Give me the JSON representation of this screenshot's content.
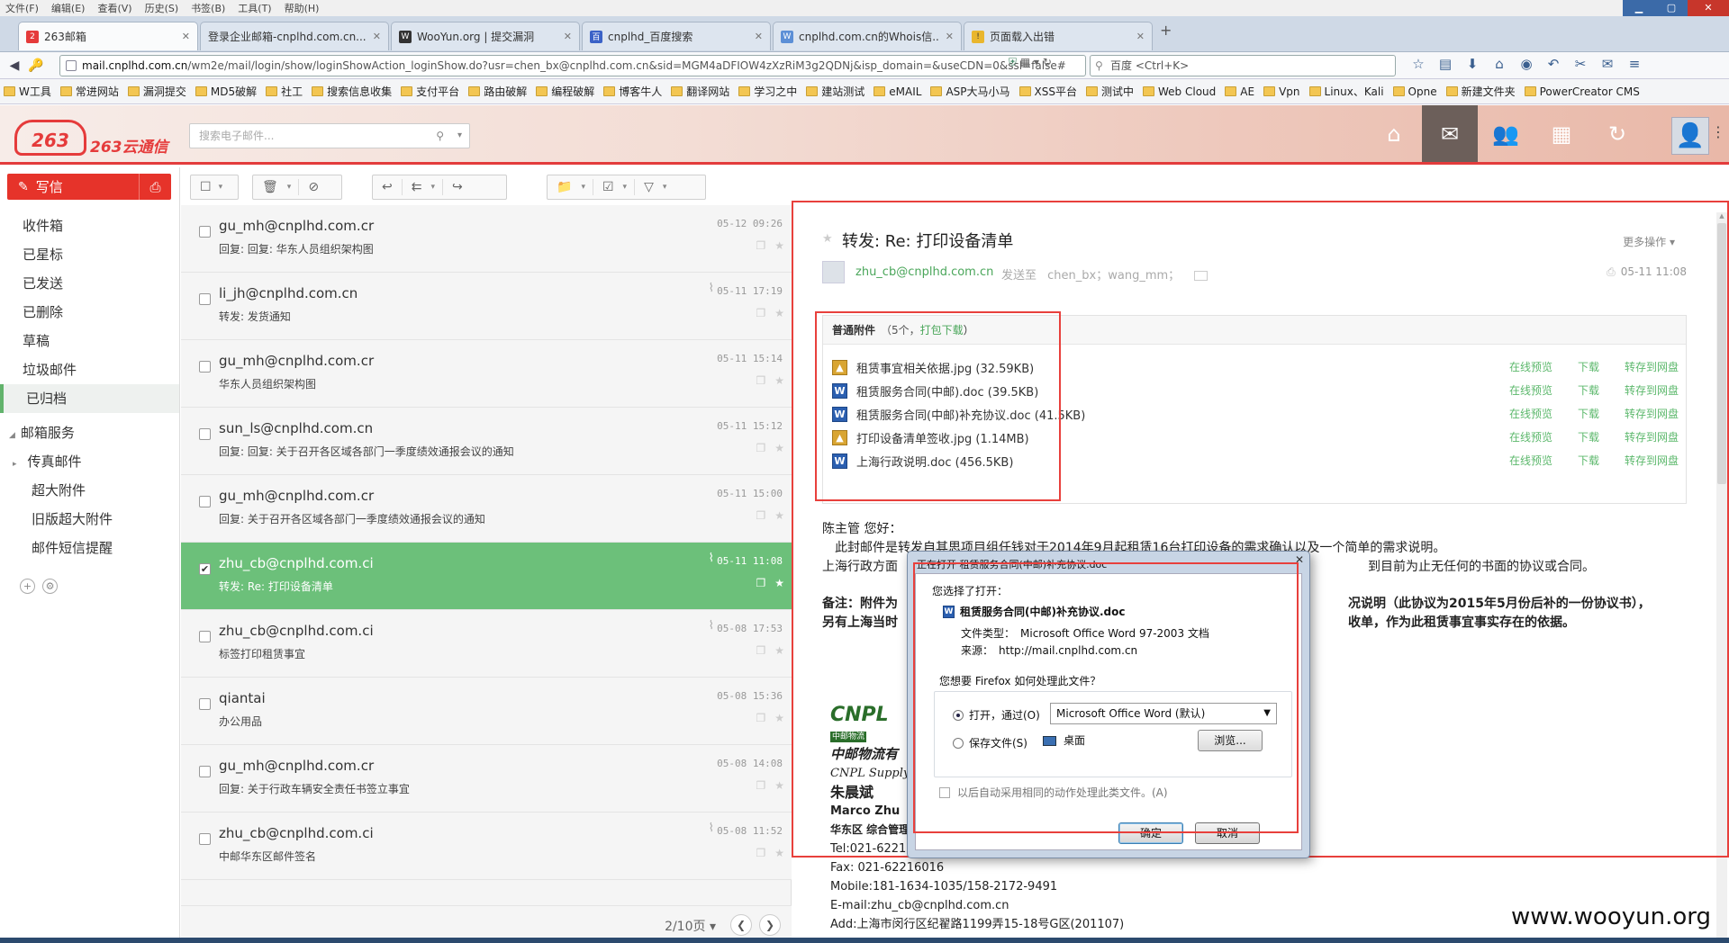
{
  "browser": {
    "menu": [
      "文件(F)",
      "编辑(E)",
      "查看(V)",
      "历史(S)",
      "书签(B)",
      "工具(T)",
      "帮助(H)"
    ],
    "tabs": [
      {
        "label": "263邮箱",
        "active": true
      },
      {
        "label": "登录企业邮箱-cnplhd.com.cn...",
        "active": false
      },
      {
        "label": "WooYun.org | 提交漏洞",
        "active": false
      },
      {
        "label": "cnplhd_百度搜索",
        "active": false
      },
      {
        "label": "cnplhd.com.cn的Whois信...",
        "active": false
      },
      {
        "label": "页面载入出错",
        "active": false
      }
    ],
    "url_host": "mail.cnplhd.com.cn",
    "url_path": "/wm2e/mail/login/show/loginShowAction_loginShow.do?usr=chen_bx@cnplhd.com.cn&sid=MGM4aDFIOW4zXzRiM3g2QDNj&isp_domain=&useCDN=0&ssl=false#",
    "search_placeholder": "百度 <Ctrl+K>",
    "bookmarks": [
      "W工具",
      "常进网站",
      "漏洞提交",
      "MD5破解",
      "社工",
      "搜索信息收集",
      "支付平台",
      "路由破解",
      "编程破解",
      "博客牛人",
      "翻译网站",
      "学习之中",
      "建站测试",
      "eMAIL",
      "ASP大马小马",
      "XSS平台",
      "测试中",
      "Web Cloud",
      "AE",
      "Vpn",
      "Linux、Kali",
      "Opne",
      "新建文件夹",
      "PowerCreator CMS"
    ]
  },
  "header": {
    "logo_text": "263云通信",
    "logo_mark": "263",
    "search_placeholder": "搜索电子邮件..."
  },
  "sidebar": {
    "compose_label": "写信",
    "items": [
      {
        "label": "收件箱"
      },
      {
        "label": "已星标"
      },
      {
        "label": "已发送"
      },
      {
        "label": "已删除"
      },
      {
        "label": "草稿"
      },
      {
        "label": "垃圾邮件"
      },
      {
        "label": "已归档",
        "selected": true
      }
    ],
    "service_head": "邮箱服务",
    "service_items": [
      {
        "label": "传真邮件"
      },
      {
        "label": "超大附件"
      },
      {
        "label": "旧版超大附件"
      },
      {
        "label": "邮件短信提醒"
      }
    ]
  },
  "mails": [
    {
      "from": "gu_mh@cnplhd.com.cr",
      "subject": "回复: 回复: 华东人员组织架构图",
      "date": "05-12 09:26",
      "attach": false,
      "selected": false
    },
    {
      "from": "li_jh@cnplhd.com.cn",
      "subject": "转发: 发货通知",
      "date": "05-11 17:19",
      "attach": true,
      "selected": false
    },
    {
      "from": "gu_mh@cnplhd.com.cr",
      "subject": "华东人员组织架构图",
      "date": "05-11 15:14",
      "attach": false,
      "selected": false
    },
    {
      "from": "sun_ls@cnplhd.com.cn",
      "subject": "回复: 回复: 关于召开各区域各部门一季度绩效通报会议的通知",
      "date": "05-11 15:12",
      "attach": false,
      "selected": false
    },
    {
      "from": "gu_mh@cnplhd.com.cr",
      "subject": "回复: 关于召开各区域各部门一季度绩效通报会议的通知",
      "date": "05-11 15:00",
      "attach": false,
      "selected": false
    },
    {
      "from": "zhu_cb@cnplhd.com.ci",
      "subject": "转发: Re: 打印设备清单",
      "date": "05-11 11:08",
      "attach": true,
      "selected": true
    },
    {
      "from": "zhu_cb@cnplhd.com.ci",
      "subject": "标签打印租赁事宜",
      "date": "05-08 17:53",
      "attach": true,
      "selected": false
    },
    {
      "from": "qiantai",
      "subject": "办公用品",
      "date": "05-08 15:36",
      "attach": false,
      "selected": false
    },
    {
      "from": "gu_mh@cnplhd.com.cr",
      "subject": "回复: 关于行政车辆安全责任书签立事宜",
      "date": "05-08 14:08",
      "attach": false,
      "selected": false
    },
    {
      "from": "zhu_cb@cnplhd.com.ci",
      "subject": "中邮华东区邮件签名",
      "date": "05-08 11:52",
      "attach": true,
      "selected": false
    }
  ],
  "pager": {
    "label": "2/10页"
  },
  "message": {
    "subject": "转发: Re: 打印设备清单",
    "more_label": "更多操作",
    "sender": "zhu_cb@cnplhd.com.cn",
    "to_label": "发送至",
    "recipients": "chen_bx；wang_mm；",
    "date": "05-11 11:08",
    "attach_title": "普通附件",
    "attach_count": "（5个，",
    "attach_pack": "打包下载",
    "attach_close": "）",
    "actions": [
      "在线预览",
      "下载",
      "转存到网盘"
    ],
    "attachments": [
      {
        "name": "租赁事宜相关依据.jpg (32.59KB)",
        "type": "img"
      },
      {
        "name": "租赁服务合同(中邮).doc (39.5KB)",
        "type": "doc"
      },
      {
        "name": "租赁服务合同(中邮)补充协议.doc (41.5KB)",
        "type": "doc"
      },
      {
        "name": "打印设备清单签收.jpg (1.14MB)",
        "type": "img"
      },
      {
        "name": "上海行政说明.doc (456.5KB)",
        "type": "doc"
      }
    ],
    "body_greeting": "陈主管 您好：",
    "body_line1": "此封邮件是转发自其思项目组任钱对于2014年9月起租赁16台打印设备的需求确认以及一个简单的需求说明。",
    "body_line2a": "上海行政方面",
    "body_line2b": "到目前为止无任何的书面的协议或合同。",
    "note_a": "备注：附件为",
    "note_a2": "况说明（此协议为2015年5月份后补的一份协议书），",
    "note_b": "另有上海当时",
    "note_b2": "收单，作为此租赁事宜事实存在的依据。",
    "sig": {
      "logo": "CNPL",
      "logo_sub": "中邮物流",
      "company_cn": "中邮物流有",
      "company_en": "CNPL Supply C",
      "name_cn": "朱晨斌",
      "name_en": "Marco Zhu",
      "dept": "华东区 综合管理",
      "tel": "Tel:021-622120",
      "fax": "Fax: 021-62216016",
      "mobile": "Mobile:181-1634-1035/158-2172-9491",
      "email": "E-mail:zhu_cb@cnplhd.com.cn",
      "addr": "Add:上海市闵行区纪翟路1199弄15-18号G区(201107)"
    }
  },
  "dialog": {
    "title": "正在打开 租赁服务合同(中邮)补充协议.doc",
    "close": "✕",
    "chosen_label": "您选择了打开：",
    "filename": "租赁服务合同(中邮)补充协议.doc",
    "type_key": "文件类型：",
    "type_val": "Microsoft Office Word 97-2003 文档",
    "src_key": "来源：",
    "src_val": "http://mail.cnplhd.com.cn",
    "question": "您想要 Firefox 如何处理此文件？",
    "open_label": "打开，通过(O)",
    "open_app": "Microsoft Office Word (默认)",
    "save_label": "保存文件(S)",
    "save_dest": "桌面",
    "browse_label": "浏览...",
    "auto_label": "以后自动采用相同的动作处理此类文件。(A)",
    "ok_label": "确定",
    "cancel_label": "取消"
  },
  "watermark": "www.wooyun.org"
}
